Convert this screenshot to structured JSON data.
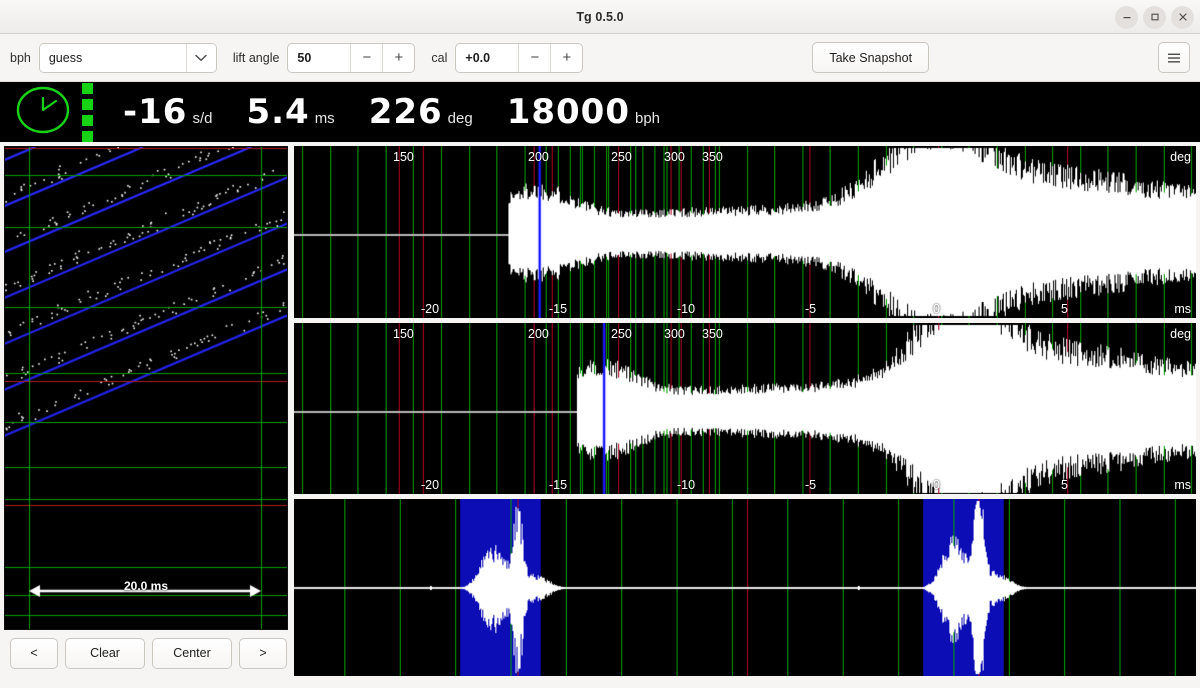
{
  "window": {
    "title": "Tg 0.5.0",
    "controls": [
      {
        "name": "minimize",
        "glyph": "–"
      },
      {
        "name": "maximize",
        "glyph": "❐"
      },
      {
        "name": "close",
        "glyph": "✕"
      }
    ]
  },
  "toolbar": {
    "bph_label": "bph",
    "bph_value": "guess",
    "bph_placeholder": "guess",
    "lift_angle_label": "lift angle",
    "lift_angle_value": "50",
    "cal_label": "cal",
    "cal_value": "+0.0",
    "minus_glyph": "−",
    "plus_glyph": "+",
    "snapshot_label": "Take Snapshot",
    "menu_icon": "hamburger-menu-icon"
  },
  "readout": {
    "status_icon": "clock-icon",
    "beat_dots": 4,
    "accent_color": "#16d316",
    "metrics": [
      {
        "value": "-16",
        "unit": "s/d"
      },
      {
        "value": "5.4",
        "unit": "ms"
      },
      {
        "value": "226",
        "unit": "deg"
      },
      {
        "value": "18000",
        "unit": "bph"
      }
    ]
  },
  "tic_graph": {
    "scale_label": "20.0 ms",
    "buttons": [
      {
        "name": "scroll-left",
        "label": "<"
      },
      {
        "name": "clear",
        "label": "Clear"
      },
      {
        "name": "center",
        "label": "Center"
      },
      {
        "name": "scroll-right",
        "label": ">"
      }
    ]
  },
  "panels": [
    {
      "name": "waveform-panel-top",
      "deg_unit": "deg",
      "ms_unit": "ms",
      "deg_ticks": [
        "150",
        "200",
        "250",
        "300",
        "350"
      ],
      "ms_ticks": [
        "-20",
        "-15",
        "-10",
        "-5",
        "0",
        "5"
      ],
      "cursor_deg": "200",
      "cursor_ms": "-15"
    },
    {
      "name": "waveform-panel-middle",
      "deg_unit": "deg",
      "ms_unit": "ms",
      "deg_ticks": [
        "150",
        "200",
        "250",
        "300",
        "350"
      ],
      "ms_ticks": [
        "-20",
        "-15",
        "-10",
        "-5",
        "0",
        "5"
      ],
      "cursor_deg": "248",
      "cursor_ms": "-13.5"
    },
    {
      "name": "waveform-panel-bottom",
      "deg_unit": "",
      "ms_unit": "",
      "deg_ticks": [],
      "ms_ticks": [],
      "cursor_deg": "",
      "cursor_ms": ""
    }
  ],
  "colors": {
    "grid_green": "#00a000",
    "grid_red": "#b00020",
    "cursor_blue": "#1a1aff",
    "highlight_blue": "#0d0db5",
    "trace_white": "#ffffff",
    "panel_bg": "#000000"
  }
}
